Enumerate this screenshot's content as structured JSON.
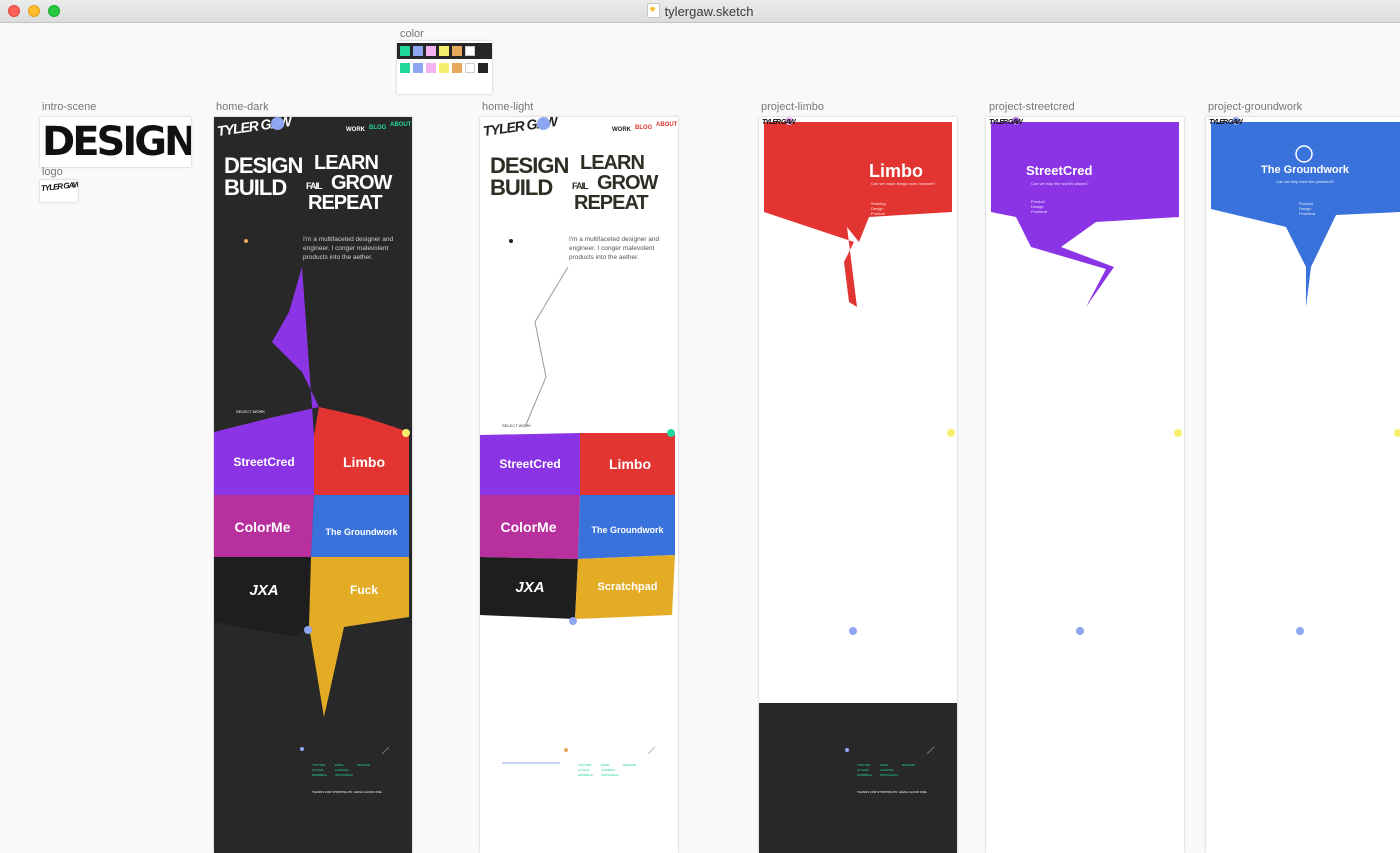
{
  "window": {
    "title": "tylergaw.sketch"
  },
  "artboards": {
    "color": "color",
    "intro_scene": "intro-scene",
    "logo": "logo",
    "home_dark": "home-dark",
    "home_light": "home-light",
    "project_limbo": "project-limbo",
    "project_streetcred": "project-streetcred",
    "project_groundwork": "project-groundwork"
  },
  "palette": {
    "row1": [
      "#20d89a",
      "#8fa7f2",
      "#f3b3f2",
      "#f5ef6d",
      "#e6a85d",
      "#ffffff",
      "#262626"
    ],
    "row2": [
      "#20d89a",
      "#8fa7f2",
      "#f3b3f2",
      "#f5ef6d",
      "#e6a85d",
      "#ffffff",
      "#262626"
    ]
  },
  "colors": {
    "dark_bg": "#282828",
    "streetcred": "#8a34e6",
    "limbo": "#e23531",
    "colorme": "#b7309e",
    "groundwork": "#3a72dc",
    "jxa": "#1e1e1e",
    "scratchpad": "#e4ac25",
    "accent_green": "#20d89a"
  },
  "intro": {
    "word": "DESIGN"
  },
  "logo_text": "TYLER GAW",
  "hero": {
    "design": "DESIGN",
    "build": "BUILD",
    "learn": "LEARN",
    "fail": "FAIL",
    "grow": "GROW",
    "repeat": "REPEAT"
  },
  "nav": {
    "work": "WORK",
    "blog": "BLOG",
    "about": "ABOUT"
  },
  "intro_paragraph": "I'm a multifaceted designer and engineer. I conger malevolent products into the aether.",
  "select_work": "SELECT WORK",
  "tiles": {
    "streetcred": "StreetCred",
    "limbo": "Limbo",
    "colorme": "ColorMe",
    "groundwork": "The Groundwork",
    "jxa": "JXA",
    "fuck": "Fuck",
    "scratchpad": "Scratchpad"
  },
  "footer": {
    "col1": [
      "TWITTER",
      "GITHUB",
      "DRIBBBLE"
    ],
    "col2": [
      "EMAIL",
      "LINKEDIN",
      "INSTAGRAM"
    ],
    "col3": [
      "RESUME"
    ],
    "line": "THANKS FOR STOPPING BY. HAVE A GOOD ONE."
  },
  "projects": {
    "limbo": {
      "title": "Limbo",
      "question": "Can we make things more humane?",
      "links": [
        "Working",
        "Design",
        "Product"
      ]
    },
    "streetcred": {
      "title": "StreetCred",
      "question": "Can we map the world's places?",
      "links": [
        "Product",
        "Design",
        "Frontend"
      ]
    },
    "groundwork": {
      "title": "The Groundwork",
      "question": "Can we help elect the president?",
      "links": [
        "Product",
        "Design",
        "Frontend"
      ]
    }
  }
}
